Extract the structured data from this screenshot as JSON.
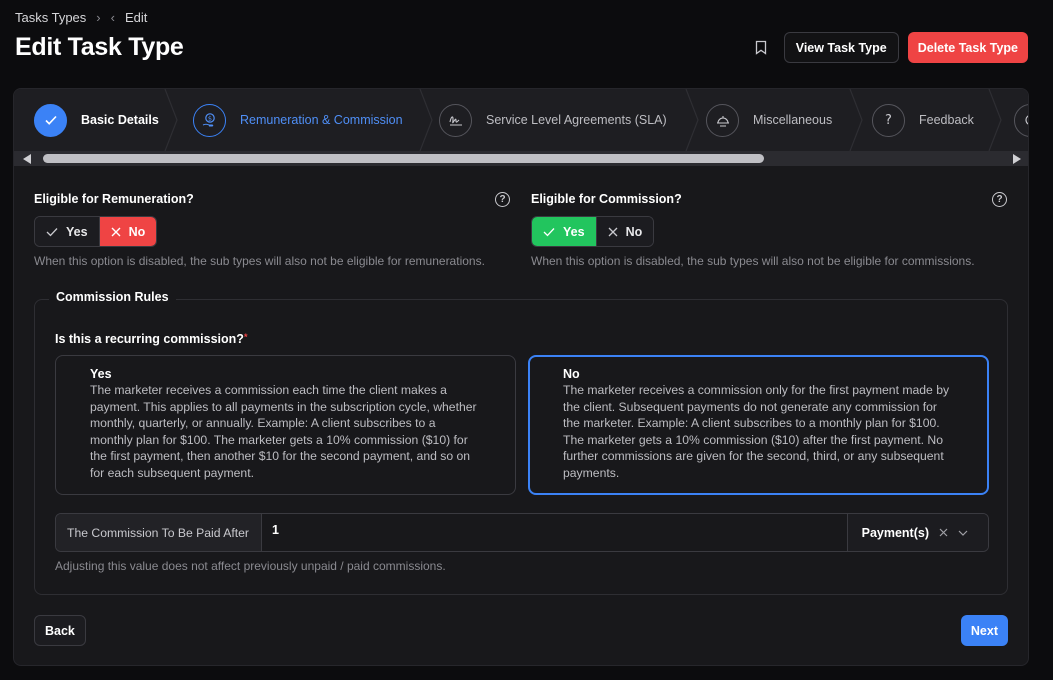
{
  "breadcrumb": {
    "parent": "Tasks Types",
    "current": "Edit"
  },
  "page": {
    "title": "Edit Task Type"
  },
  "header": {
    "view_label": "View Task Type",
    "delete_label": "Delete Task Type"
  },
  "steps": [
    {
      "label": "Basic Details",
      "state": "done"
    },
    {
      "label": "Remuneration & Commission",
      "state": "active"
    },
    {
      "label": "Service Level Agreements (SLA)",
      "state": "pending"
    },
    {
      "label": "Miscellaneous",
      "state": "pending"
    },
    {
      "label": "Feedback",
      "state": "pending"
    }
  ],
  "remuneration": {
    "label": "Eligible for Remuneration?",
    "yes": "Yes",
    "no": "No",
    "selected": "No",
    "hint": "When this option is disabled, the sub types will also not be eligible for remunerations."
  },
  "commission": {
    "label": "Eligible for Commission?",
    "yes": "Yes",
    "no": "No",
    "selected": "Yes",
    "hint": "When this option is disabled, the sub types will also not be eligible for commissions."
  },
  "rules": {
    "legend": "Commission Rules",
    "question": "Is this a recurring commission?",
    "required_mark": "*",
    "yes_title": "Yes",
    "yes_desc": "The marketer receives a commission each time the client makes a payment. This applies to all payments in the subscription cycle, whether monthly, quarterly, or annually. Example: A client subscribes to a monthly plan for $100. The marketer gets a 10% commission ($10) for the first payment, then another $10 for the second payment, and so on for each subsequent payment.",
    "no_title": "No",
    "no_desc": "The marketer receives a commission only for the first payment made by the client. Subsequent payments do not generate any commission for the marketer. Example: A client subscribes to a monthly plan for $100. The marketer gets a 10% commission ($10) after the first payment. No further commissions are given for the second, third, or any subsequent payments.",
    "selected": "No",
    "after_label": "The Commission To Be Paid After",
    "after_value": "1",
    "after_unit": "Payment(s)",
    "after_hint": "Adjusting this value does not affect previously unpaid / paid commissions."
  },
  "footer": {
    "back_label": "Back",
    "next_label": "Next"
  },
  "colors": {
    "accent": "#3b82f6",
    "danger": "#ef4444",
    "success": "#22c55e"
  }
}
